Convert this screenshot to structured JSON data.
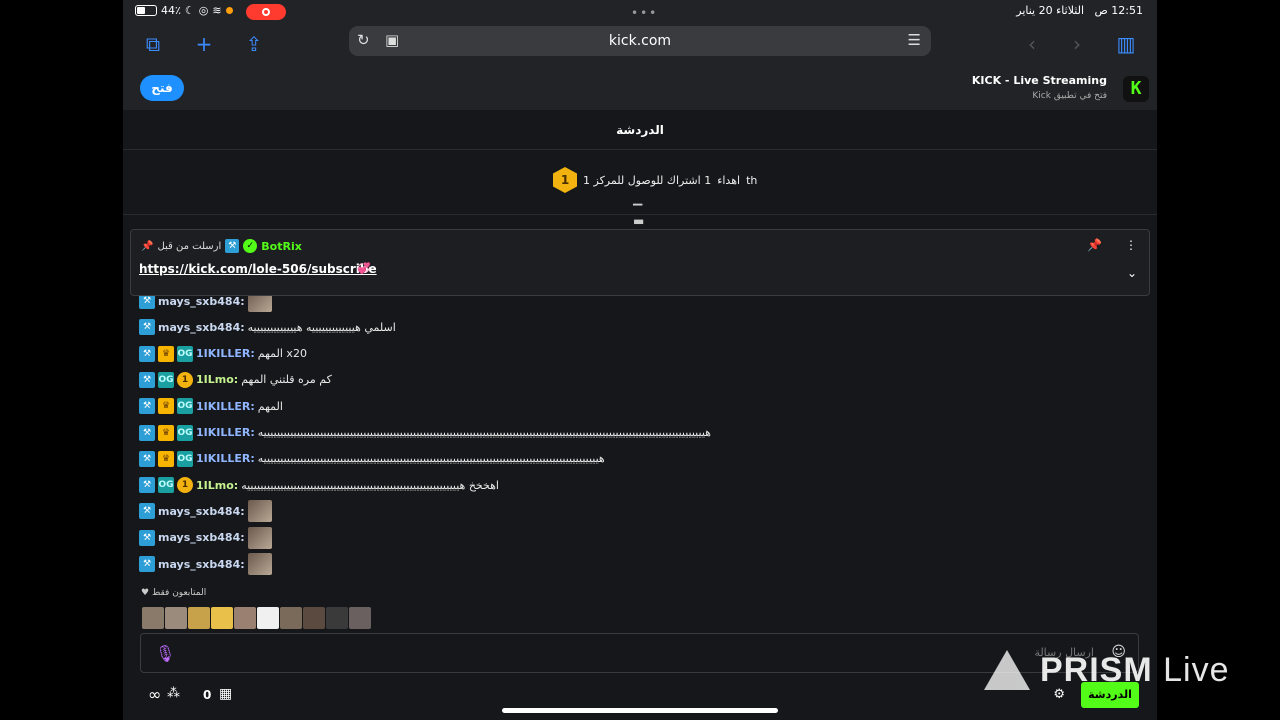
{
  "status_bar": {
    "battery": "44٪",
    "time": "12:51 ص",
    "date": "الثلاثاء 20 يناير",
    "dots": "•••"
  },
  "browser": {
    "url": "kick.com",
    "icons": [
      "tabs-icon",
      "new-tab-icon",
      "share-icon",
      "reload-icon",
      "site-settings-icon",
      "reader-icon",
      "back-icon",
      "forward-icon",
      "sidebar-icon"
    ]
  },
  "app_banner": {
    "open_label": "فتح",
    "title": "KICK - Live Streaming",
    "subtitle": "فتح في تطبيق Kick",
    "logo_letter": "K"
  },
  "chat": {
    "header_title": "الدردشة",
    "goal": {
      "badge_number": "1",
      "text": "1 اشتراك للوصول للمركز 1",
      "prefix": "اهداء",
      "suffix": "th"
    },
    "pinned": {
      "pinned_by_label": "ارسلت من قبل",
      "username": "BotRix",
      "link": "https://kick.com/lole-506/subscribe",
      "emoji": "💞"
    },
    "messages": [
      {
        "user": "mays_sxb484:",
        "text": "",
        "emote": true,
        "badges": [
          "mod"
        ]
      },
      {
        "user": "mays_sxb484:",
        "text": "اسلمي هيييييييييييييه هيييييييييييييه",
        "emote": false,
        "badges": [
          "mod"
        ]
      },
      {
        "user": "1IKILLER:",
        "text": "المهم x20",
        "emote": false,
        "badges": [
          "mod",
          "vip",
          "og"
        ]
      },
      {
        "user": "1ILmo:",
        "text": "كم مره قلتني المهم",
        "emote": false,
        "badges": [
          "mod",
          "og",
          "sub"
        ]
      },
      {
        "user": "1IKILLER:",
        "text": "المهم",
        "emote": false,
        "badges": [
          "mod",
          "vip",
          "og"
        ]
      },
      {
        "user": "1IKILLER:",
        "text": "هيييييييييييييييييييييييييييييييييييييييييييييييييييييييييييييييييييييييييييييييييييييييييييييييييييييييييييييييييييييييييييييييييييييه",
        "emote": false,
        "badges": [
          "mod",
          "vip",
          "og"
        ]
      },
      {
        "user": "1IKILLER:",
        "text": "هيييييييييييييييييييييييييييييييييييييييييييييييييييييييييييييييييييييييييييييييييييييييييييييييييييييه",
        "emote": false,
        "badges": [
          "mod",
          "vip",
          "og"
        ]
      },
      {
        "user": "1ILmo:",
        "text": "اهخخخ هييييييييييييييييييييييييييييييييييييييييييييييييييييييييييييييييه",
        "emote": false,
        "badges": [
          "mod",
          "og",
          "sub"
        ]
      },
      {
        "user": "mays_sxb484:",
        "text": "",
        "emote": true,
        "badges": [
          "mod"
        ]
      },
      {
        "user": "mays_sxb484:",
        "text": "",
        "emote": true,
        "badges": [
          "mod"
        ]
      },
      {
        "user": "mays_sxb484:",
        "text": "",
        "emote": true,
        "badges": [
          "mod"
        ]
      }
    ],
    "followers_only": "المتابعون فقط",
    "input_placeholder": "ارسال رسالة",
    "bottom": {
      "count": "0",
      "chat_button": "الدردشة"
    }
  },
  "watermark": {
    "brand": "PRISM",
    "suffix": "Live"
  }
}
